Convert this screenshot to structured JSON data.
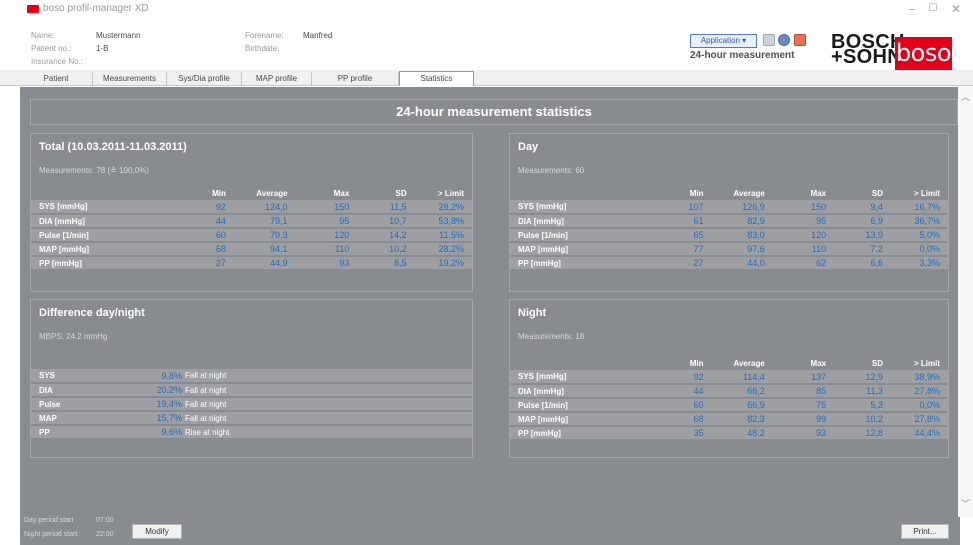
{
  "app": {
    "title": "boso profil-manager XD"
  },
  "window_controls": {
    "minimize": "–",
    "maximize": "☐",
    "close": "✕"
  },
  "patient": {
    "name_label": "Name:",
    "name": "Mustermann",
    "patient_no_label": "Patient no.:",
    "patient_no": "1-B",
    "insurance_label": "Insurance No.:",
    "forename_label": "Forename:",
    "forename": "Manfred",
    "birthdate_label": "Birthdate:"
  },
  "toolbar": {
    "application_label": "Application ▾",
    "mode_title": "24-hour measurement",
    "icons": [
      "document-icon",
      "globe-icon",
      "stop-icon"
    ]
  },
  "logo": {
    "bosch_line1": "BOSCH",
    "bosch_line2": "+SOHN",
    "boso": "boso",
    "boso_color": "#e3001b"
  },
  "tabs": [
    {
      "label": "Patient"
    },
    {
      "label": "Measurements"
    },
    {
      "label": "Sys/Dia profile"
    },
    {
      "label": "MAP profile"
    },
    {
      "label": "PP profile"
    },
    {
      "label": "Statistics",
      "active": true
    }
  ],
  "main": {
    "title": "24-hour measurement statistics",
    "headers": [
      "Min",
      "Average",
      "Max",
      "SD",
      "> Limit"
    ],
    "total": {
      "title": "Total (10.03.2011-11.03.2011)",
      "subtitle": "Measurements: 78 (≙ 100,0%)",
      "rows": [
        [
          "SYS [mmHg]",
          "92",
          "124,0",
          "150",
          "11,5",
          "28,2%"
        ],
        [
          "DIA [mmHg]",
          "44",
          "79,1",
          "95",
          "10,7",
          "53,8%"
        ],
        [
          "Pulse [1/min]",
          "60",
          "79,3",
          "120",
          "14,2",
          "11,5%"
        ],
        [
          "MAP [mmHg]",
          "68",
          "94,1",
          "110",
          "10,2",
          "28,2%"
        ],
        [
          "PP [mmHg]",
          "27",
          "44,9",
          "93",
          "8,5",
          "19,2%"
        ]
      ]
    },
    "day": {
      "title": "Day",
      "subtitle": "Measurements: 60",
      "rows": [
        [
          "SYS [mmHg]",
          "107",
          "126,9",
          "150",
          "9,4",
          "16,7%"
        ],
        [
          "DIA [mmHg]",
          "61",
          "82,9",
          "95",
          "6,9",
          "36,7%"
        ],
        [
          "Pulse [1/min]",
          "65",
          "83,0",
          "120",
          "13,9",
          "5,0%"
        ],
        [
          "MAP [mmHg]",
          "77",
          "97,6",
          "110",
          "7,2",
          "0,0%"
        ],
        [
          "PP [mmHg]",
          "27",
          "44,0",
          "62",
          "6,6",
          "3,3%"
        ]
      ]
    },
    "difference": {
      "title": "Difference day/night",
      "subtitle": "MBPS: 24,2 mmHg",
      "rows": [
        [
          "SYS",
          "9,8%",
          "Fall at night"
        ],
        [
          "DIA",
          "20,2%",
          "Fall at night"
        ],
        [
          "Pulse",
          "19,4%",
          "Fall at night"
        ],
        [
          "MAP",
          "15,7%",
          "Fall at night"
        ],
        [
          "PP",
          "9,6%",
          "Rise at night"
        ]
      ]
    },
    "night": {
      "title": "Night",
      "subtitle": "Measurements: 18",
      "rows": [
        [
          "SYS [mmHg]",
          "92",
          "114,4",
          "137",
          "12,9",
          "38,9%"
        ],
        [
          "DIA [mmHg]",
          "44",
          "66,2",
          "85",
          "11,3",
          "27,8%"
        ],
        [
          "Pulse [1/min]",
          "60",
          "66,9",
          "75",
          "5,3",
          "0,0%"
        ],
        [
          "MAP [mmHg]",
          "68",
          "82,3",
          "99",
          "10,2",
          "27,8%"
        ],
        [
          "PP [mmHg]",
          "35",
          "48,2",
          "93",
          "12,8",
          "44,4%"
        ]
      ]
    }
  },
  "footer": {
    "day_period_label": "Day period start",
    "day_period_value": "07:00",
    "night_period_label": "Night period start",
    "night_period_value": "22:00",
    "modify_label": "Modify",
    "print_label": "Print..."
  },
  "colors": {
    "panel": "#888b8f",
    "row": "#9d9fa3",
    "value": "#1f6fc0"
  }
}
